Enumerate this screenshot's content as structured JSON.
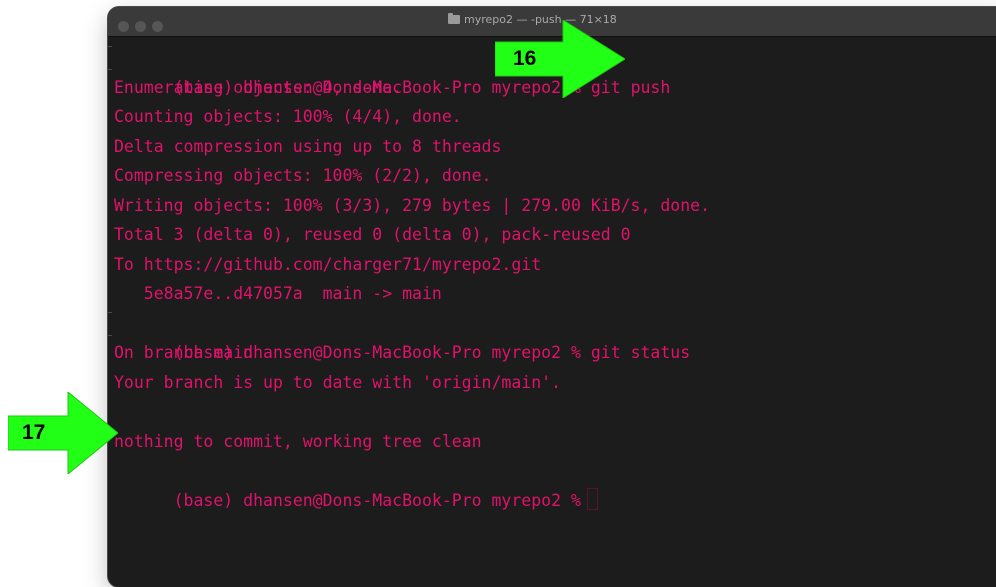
{
  "window": {
    "title": "myrepo2 — -push — 71×18",
    "traffic_lights": [
      "close",
      "minimize",
      "zoom"
    ],
    "scroll_indicator": "E"
  },
  "terminal": {
    "lines": [
      "(base) dhansen@Dons-MacBook-Pro myrepo2 % git push",
      "Enumerating objects: 4, done.",
      "Counting objects: 100% (4/4), done.",
      "Delta compression using up to 8 threads",
      "Compressing objects: 100% (2/2), done.",
      "Writing objects: 100% (3/3), 279 bytes | 279.00 KiB/s, done.",
      "Total 3 (delta 0), reused 0 (delta 0), pack-reused 0",
      "To https://github.com/charger71/myrepo2.git",
      "   5e8a57e..d47057a  main -> main",
      "(base) dhansen@Dons-MacBook-Pro myrepo2 % git status",
      "On branch main",
      "Your branch is up to date with 'origin/main'.",
      "",
      "nothing to commit, working tree clean",
      "(base) dhansen@Dons-MacBook-Pro myrepo2 %"
    ]
  },
  "annotations": [
    {
      "label": "16",
      "color": "#22ff16"
    },
    {
      "label": "17",
      "color": "#22ff16"
    }
  ],
  "colors": {
    "terminal_text": "#e0126b",
    "terminal_bg": "#1c1c1c",
    "arrow": "#22ff16"
  }
}
